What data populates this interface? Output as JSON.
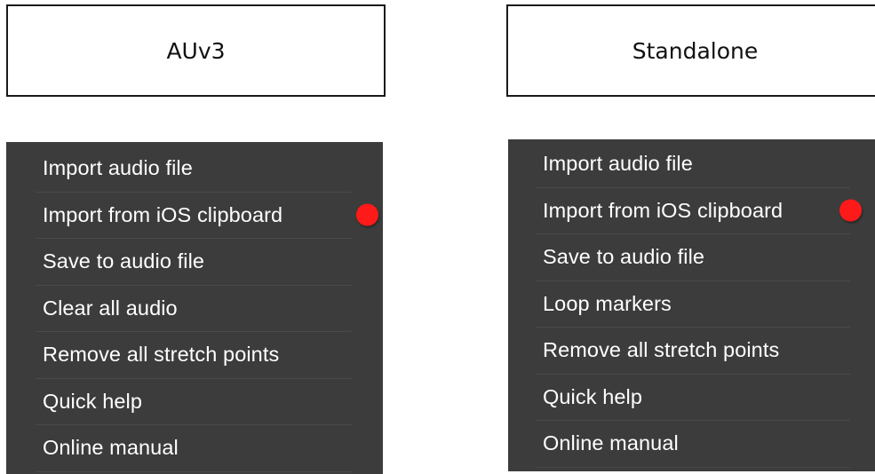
{
  "auv3": {
    "title": "AUv3",
    "menu_items": [
      "Import audio file",
      "Import from iOS clipboard",
      "Save to audio file",
      "Clear all audio",
      "Remove all stretch points",
      "Quick help",
      "Online manual"
    ],
    "highlighted_item_index": 1
  },
  "standalone": {
    "title": "Standalone",
    "menu_items": [
      "Import audio file",
      "Import from iOS clipboard",
      "Save to audio file",
      "Loop markers",
      "Remove all stretch points",
      "Quick help",
      "Online manual"
    ],
    "highlighted_item_index": 1
  },
  "colors": {
    "menu_background": "#3c3c3c",
    "menu_text": "#ffffff",
    "marker": "#ff1a1a"
  },
  "icons": {
    "marker": "red-dot-marker-icon"
  }
}
